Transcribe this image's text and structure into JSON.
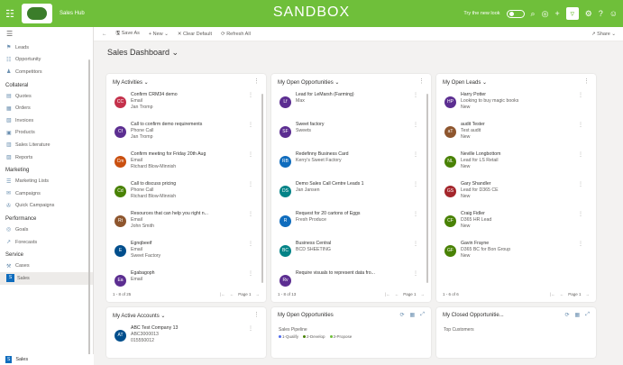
{
  "header": {
    "app_name": "Sales Hub",
    "env_title": "SANDBOX",
    "toggle_label": "Try the new look",
    "icons": [
      "search-icon",
      "lightbulb-icon",
      "plus-icon",
      "filter-icon",
      "gear-icon",
      "help-icon",
      "user-icon"
    ],
    "accent": "#6fbf3a"
  },
  "commandbar": {
    "save_as": "Save As",
    "new": "New",
    "clear_default": "Clear Default",
    "refresh": "Refresh All",
    "share": "Share"
  },
  "sidebar": {
    "groups": [
      {
        "items": [
          {
            "label": "Leads",
            "icon": "⚑"
          },
          {
            "label": "Opportunity",
            "icon": "☷"
          },
          {
            "label": "Competitors",
            "icon": "♟"
          }
        ]
      },
      {
        "title": "Collateral",
        "items": [
          {
            "label": "Quotes",
            "icon": "▤"
          },
          {
            "label": "Orders",
            "icon": "▦"
          },
          {
            "label": "Invoices",
            "icon": "▧"
          },
          {
            "label": "Products",
            "icon": "▣"
          },
          {
            "label": "Sales Literature",
            "icon": "▥"
          },
          {
            "label": "Reports",
            "icon": "▨"
          }
        ]
      },
      {
        "title": "Marketing",
        "items": [
          {
            "label": "Marketing Lists",
            "icon": "☰"
          },
          {
            "label": "Campaigns",
            "icon": "✉"
          },
          {
            "label": "Quick Campaigns",
            "icon": "✇"
          }
        ]
      },
      {
        "title": "Performance",
        "items": [
          {
            "label": "Goals",
            "icon": "◎"
          },
          {
            "label": "Forecasts",
            "icon": "↗"
          }
        ]
      },
      {
        "title": "Service",
        "items": [
          {
            "label": "Cases",
            "icon": "⚒"
          },
          {
            "label": "Sales",
            "icon": "S",
            "active": true
          }
        ]
      }
    ]
  },
  "dashboard": {
    "title": "Sales Dashboard"
  },
  "activities": {
    "title": "My Activities",
    "rows": [
      {
        "initials": "CC",
        "color": "#c4314b",
        "lines": [
          "Confirm CRM34 demo",
          "Email",
          "Jan Tromp"
        ]
      },
      {
        "initials": "Cf",
        "color": "#5c2e91",
        "lines": [
          "Call to confirm demo requirements",
          "Phone Call",
          "Jan Tromp"
        ]
      },
      {
        "initials": "Cm",
        "color": "#ca5010",
        "lines": [
          "Confirm meeting for Friday 20th Aug",
          "Email",
          "Richard Blow-Minnish"
        ]
      },
      {
        "initials": "Cd",
        "color": "#498205",
        "lines": [
          "Call to discuss pricing",
          "Phone Call",
          "Richard Blow-Minnish"
        ]
      },
      {
        "initials": "Rt",
        "color": "#8e562e",
        "lines": [
          "Resources that can help you right n...",
          "Email",
          "John Smith"
        ]
      },
      {
        "initials": "E",
        "color": "#004e8c",
        "lines": [
          "Egnqbeeif",
          "Email",
          "Sweet Factory"
        ]
      },
      {
        "initials": "Ea",
        "color": "#5c2e91",
        "lines": [
          "Egabagoph",
          "Email"
        ]
      }
    ],
    "pager": {
      "range": "1 - 8 of 25",
      "page": "Page 1"
    }
  },
  "opportunities": {
    "title": "My Open Opportunities",
    "rows": [
      {
        "initials": "Lf",
        "color": "#5c2e91",
        "lines": [
          "Lead for LeMarsh (Farming)",
          "Max"
        ]
      },
      {
        "initials": "SF",
        "color": "#5c2e91",
        "lines": [
          "Sweet factory",
          "Sweets"
        ]
      },
      {
        "initials": "RB",
        "color": "#0f6cbd",
        "lines": [
          "Redefinny Business Card",
          "Kerry's Sweet Factory"
        ]
      },
      {
        "initials": "DS",
        "color": "#038387",
        "lines": [
          "Demo Sales Call Centre Leads 1",
          "Jan Jansen"
        ]
      },
      {
        "initials": "R",
        "color": "#0f6cbd",
        "lines": [
          "Request for 20 cartons of Eggs",
          "Fresh Produce"
        ]
      },
      {
        "initials": "BC",
        "color": "#038387",
        "lines": [
          "Business Central",
          "BCD SHEETING"
        ]
      },
      {
        "initials": "Rv",
        "color": "#5c2e91",
        "lines": [
          "Require visuals to represent data fro..."
        ]
      }
    ],
    "pager": {
      "range": "1 - 8 of 13",
      "page": "Page 1"
    }
  },
  "leads": {
    "title": "My Open Leads",
    "rows": [
      {
        "initials": "HP",
        "color": "#5c2e91",
        "lines": [
          "Harry Potter",
          "Looking to buy magic books",
          "New"
        ]
      },
      {
        "initials": "aT",
        "color": "#8e562e",
        "lines": [
          "audit Tester",
          "Test audit",
          "New"
        ]
      },
      {
        "initials": "NL",
        "color": "#498205",
        "lines": [
          "Neville Longbottom",
          "Lead for LS Retail",
          "New"
        ]
      },
      {
        "initials": "GS",
        "color": "#a4262c",
        "lines": [
          "Gary Shandler",
          "Lead for D365 CE",
          "New"
        ]
      },
      {
        "initials": "CF",
        "color": "#498205",
        "lines": [
          "Craig Fidler",
          "D365 HR Lead",
          "New"
        ]
      },
      {
        "initials": "GF",
        "color": "#498205",
        "lines": [
          "Gavin Frayne",
          "D365 BC for Bon Group",
          "New"
        ]
      }
    ],
    "pager": {
      "range": "1 - 6 of 6",
      "page": "Page 1"
    }
  },
  "accounts": {
    "title": "My Active Accounts",
    "row": {
      "initials": "AT",
      "color": "#004e8c",
      "lines": [
        "ABC Test Company 13",
        "ABC3000013",
        "015550012"
      ]
    }
  },
  "opp_chart": {
    "title": "My Open Opportunities",
    "subtitle": "Sales Pipeline",
    "legend": [
      {
        "label": "1-Qualify",
        "color": "#4f6bed"
      },
      {
        "label": "2-Develop",
        "color": "#498205"
      },
      {
        "label": "3-Propose",
        "color": "#6fbf3a"
      }
    ],
    "icons": [
      "refresh-icon",
      "chart-icon",
      "expand-icon"
    ]
  },
  "closed_chart": {
    "title": "My Closed Opportunitie...",
    "subtitle": "Top Customers",
    "icons": [
      "refresh-icon",
      "chart-icon",
      "expand-icon"
    ]
  }
}
